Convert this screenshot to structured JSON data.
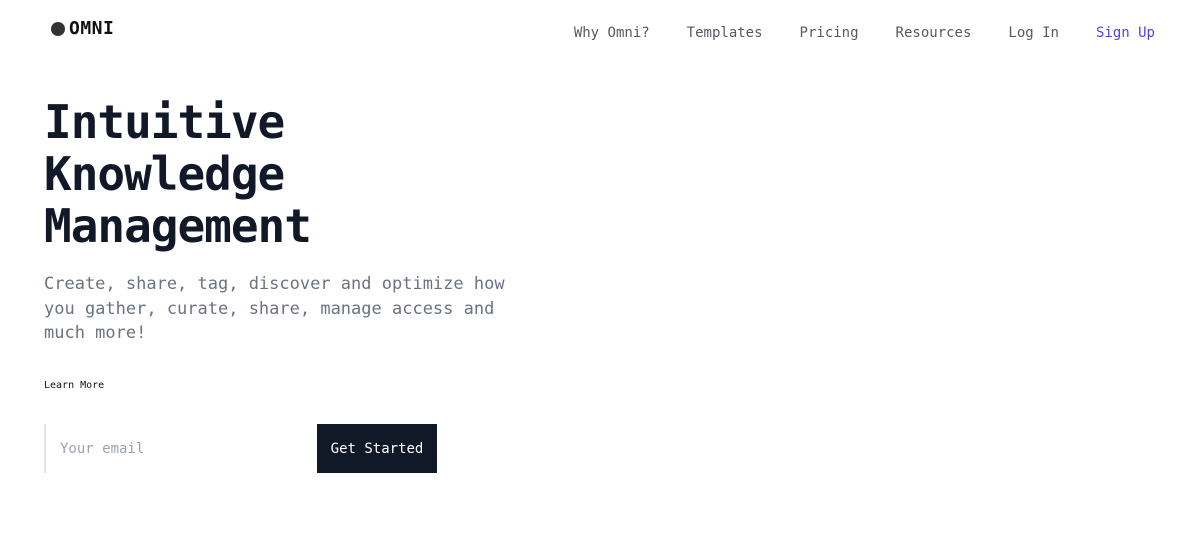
{
  "brand": {
    "name": "OMNI",
    "icon": "circle-logo-icon"
  },
  "nav": {
    "items": [
      {
        "label": "Why Omni?"
      },
      {
        "label": "Templates"
      },
      {
        "label": "Pricing"
      },
      {
        "label": "Resources"
      },
      {
        "label": "Log In"
      },
      {
        "label": "Sign Up"
      }
    ]
  },
  "hero": {
    "title_lines": [
      "Intuitive",
      "Knowledge",
      "Management"
    ],
    "subtitle": "Create, share, tag, discover and optimize how you gather, curate, share, manage access and much more!",
    "learn_more": "Learn More"
  },
  "signup": {
    "email_placeholder": "Your email",
    "email_value": "",
    "button_label": "Get Started"
  },
  "colors": {
    "accent": "#4f46e5",
    "dark": "#111827",
    "muted_text": "#6b7280",
    "nav_text": "#555a63"
  }
}
